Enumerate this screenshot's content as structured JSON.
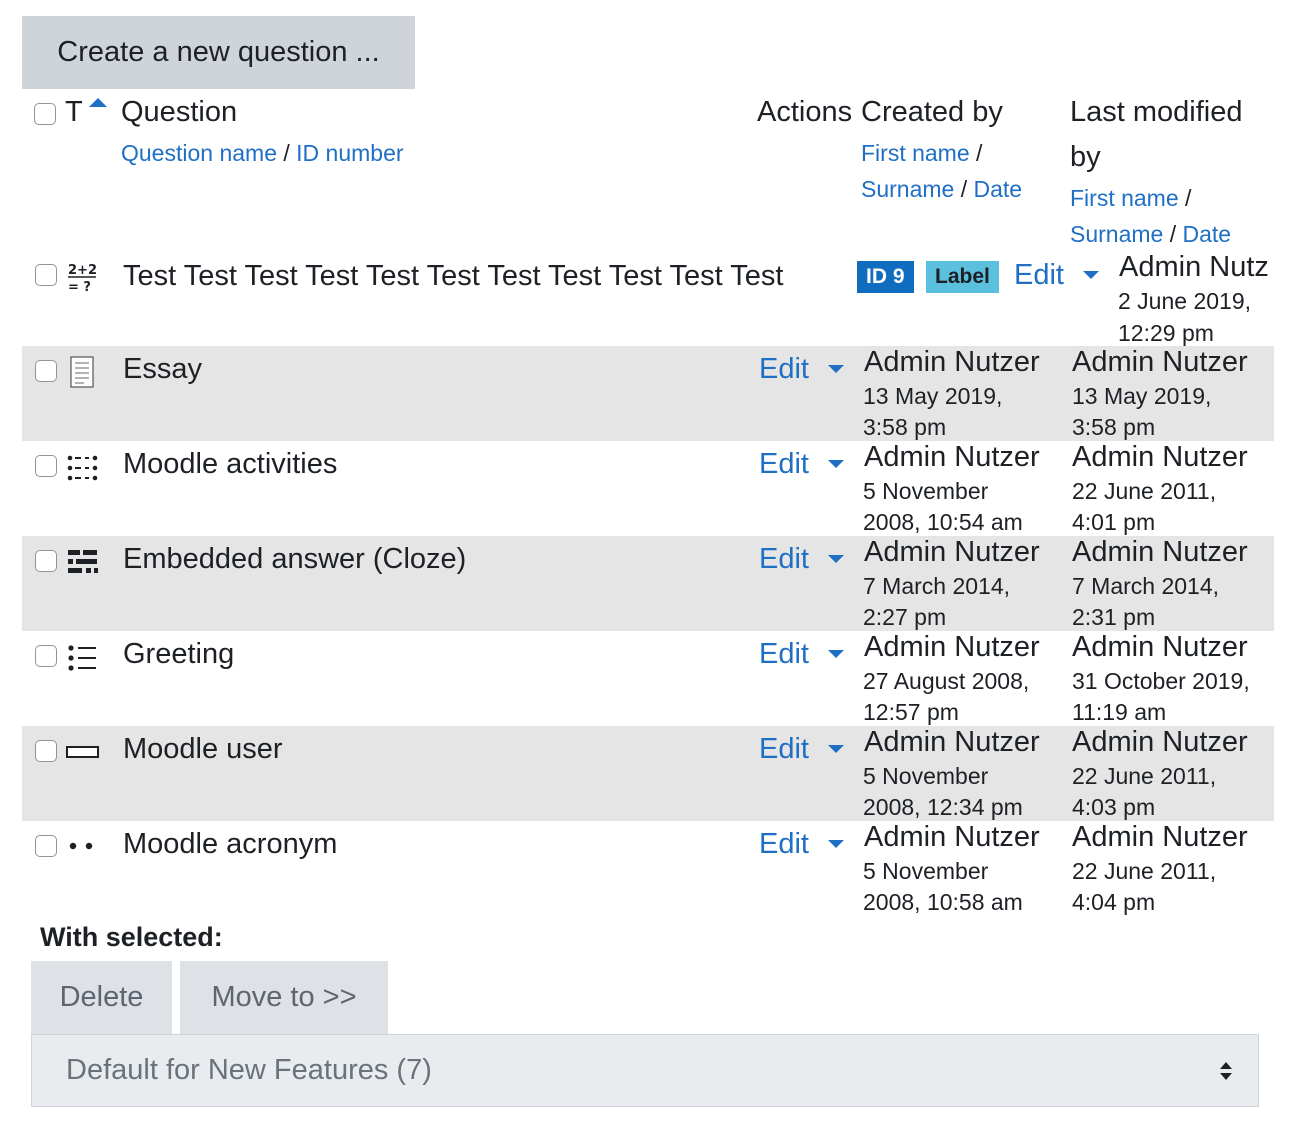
{
  "create_button": "Create a new question ...",
  "header": {
    "type_sort": "T",
    "question": "Question",
    "question_name": "Question name",
    "separator": "/",
    "id_number": "ID number",
    "actions": "Actions",
    "created_by": "Created by",
    "first_name": "First name",
    "surname": "Surname",
    "date": "Date",
    "last_modified_line1": "Last modified",
    "last_modified_line2": "by"
  },
  "edit_label": "Edit",
  "questions": [
    {
      "name": "Test Test Test Test Test Test Test Test Test Test Test",
      "icon": "calculated-icon",
      "id_badge": "ID 9",
      "label_badge": "Label",
      "created_by": "Admin Nutz",
      "created_date_1": "2 June 2019,",
      "created_date_2": "12:29 pm"
    },
    {
      "name": "Essay",
      "icon": "essay-icon",
      "created_by": "Admin Nutzer",
      "created_date_1": "13 May 2019,",
      "created_date_2": "3:58 pm",
      "modified_by": "Admin Nutzer",
      "modified_date_1": "13 May 2019,",
      "modified_date_2": "3:58 pm"
    },
    {
      "name": "Moodle activities",
      "icon": "matching-icon",
      "created_by": "Admin Nutzer",
      "created_date_1": "5 November",
      "created_date_2": "2008, 10:54 am",
      "modified_by": "Admin Nutzer",
      "modified_date_1": "22 June 2011,",
      "modified_date_2": "4:01 pm"
    },
    {
      "name": "Embedded answer (Cloze)",
      "icon": "cloze-icon",
      "created_by": "Admin Nutzer",
      "created_date_1": "7 March 2014,",
      "created_date_2": "2:27 pm",
      "modified_by": "Admin Nutzer",
      "modified_date_1": "7 March 2014,",
      "modified_date_2": "2:31 pm"
    },
    {
      "name": "Greeting",
      "icon": "multichoice-icon",
      "created_by": "Admin Nutzer",
      "created_date_1": "27 August 2008,",
      "created_date_2": "12:57 pm",
      "modified_by": "Admin Nutzer",
      "modified_date_1": "31 October 2019,",
      "modified_date_2": "11:19 am"
    },
    {
      "name": "Moodle user",
      "icon": "shortanswer-icon",
      "created_by": "Admin Nutzer",
      "created_date_1": "5 November",
      "created_date_2": "2008, 12:34 pm",
      "modified_by": "Admin Nutzer",
      "modified_date_1": "22 June 2011,",
      "modified_date_2": "4:03 pm"
    },
    {
      "name": "Moodle acronym",
      "icon": "truefalse-icon",
      "created_by": "Admin Nutzer",
      "created_date_1": "5 November",
      "created_date_2": "2008, 10:58 am",
      "modified_by": "Admin Nutzer",
      "modified_date_1": "22 June 2011,",
      "modified_date_2": "4:04 pm"
    }
  ],
  "footer": {
    "with_selected": "With selected:",
    "delete": "Delete",
    "move_to": "Move to >>",
    "category_select": "Default for New Features (7)"
  },
  "colors": {
    "link": "#1f6fc5",
    "row_shade": "#e5e5e5",
    "id_badge": "#0f6cbf",
    "label_badge": "#5bc0de"
  }
}
